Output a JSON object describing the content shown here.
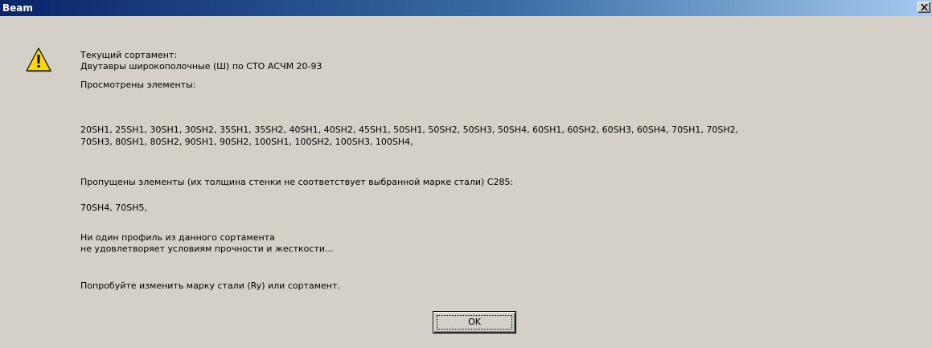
{
  "window": {
    "title": "Beam",
    "close_glyph": "×"
  },
  "icon": {
    "name": "warning-icon",
    "color": "#ffd800"
  },
  "message": {
    "assortment_label": "Текущий сортамент:",
    "assortment_name": "Двутавры широкополочные (Ш) по СТО АСЧМ 20-93",
    "viewed_label": "Просмотрены элементы:",
    "viewed_line1": "20SH1, 25SH1, 30SH1, 30SH2, 35SH1, 35SH2, 40SH1, 40SH2, 45SH1, 50SH1, 50SH2, 50SH3, 50SH4, 60SH1, 60SH2, 60SH3, 60SH4, 70SH1, 70SH2,",
    "viewed_line2": "70SH3, 80SH1, 80SH2, 90SH1, 90SH2, 100SH1, 100SH2, 100SH3, 100SH4,",
    "skipped_label": "Пропущены элементы (их толщина стенки не соответствует выбранной марке стали) С285:",
    "skipped_list": "70SH4, 70SH5,",
    "result_line1": "Ни один профиль из данного сортамента",
    "result_line2": "не удовлетворяет условиям прочности и жесткости...",
    "advice": "Попробуйте изменить марку стали (Ry) или сортамент."
  },
  "buttons": {
    "ok_label": "OK"
  }
}
